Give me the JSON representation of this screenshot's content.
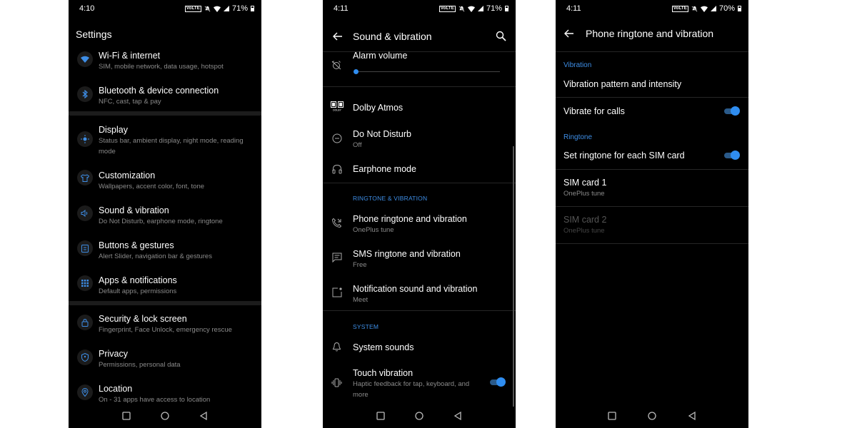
{
  "accent": "#3e8ee6",
  "screen1": {
    "status": {
      "time": "4:10",
      "battery": "71%",
      "volte": "VoLTE"
    },
    "title": "Settings",
    "items": [
      {
        "title": "Wi-Fi & internet",
        "sub": "SIM, mobile network, data usage, hotspot",
        "icon": "wifi-icon"
      },
      {
        "title": "Bluetooth & device connection",
        "sub": "NFC, cast, tap & pay",
        "icon": "bluetooth-icon"
      },
      {
        "title": "Display",
        "sub": "Status bar, ambient display, night mode, reading mode",
        "icon": "brightness-icon"
      },
      {
        "title": "Customization",
        "sub": "Wallpapers, accent color, font, tone",
        "icon": "shirt-icon"
      },
      {
        "title": "Sound & vibration",
        "sub": "Do Not Disturb, earphone mode, ringtone",
        "icon": "speaker-icon"
      },
      {
        "title": "Buttons & gestures",
        "sub": "Alert Slider, navigation bar & gestures",
        "icon": "buttons-icon"
      },
      {
        "title": "Apps & notifications",
        "sub": "Default apps, permissions",
        "icon": "apps-grid-icon"
      },
      {
        "title": "Security & lock screen",
        "sub": "Fingerprint, Face Unlock, emergency rescue",
        "icon": "lock-icon"
      },
      {
        "title": "Privacy",
        "sub": "Permissions, personal data",
        "icon": "shield-icon"
      },
      {
        "title": "Location",
        "sub": "On - 31 apps have access to location",
        "icon": "location-pin-icon"
      }
    ]
  },
  "screen2": {
    "status": {
      "time": "4:11",
      "battery": "71%",
      "volte": "VoLTE"
    },
    "title": "Sound & vibration",
    "alarm": {
      "title": "Alarm volume",
      "level": 0.0
    },
    "items_top": [
      {
        "title": "Dolby Atmos",
        "sub": ""
      },
      {
        "title": "Do Not Disturb",
        "sub": "Off"
      },
      {
        "title": "Earphone mode",
        "sub": ""
      }
    ],
    "section_ringtone": "RINGTONE & VIBRATION",
    "items_ringtone": [
      {
        "title": "Phone ringtone and vibration",
        "sub": "OnePlus tune"
      },
      {
        "title": "SMS ringtone and vibration",
        "sub": "Free"
      },
      {
        "title": "Notification sound and vibration",
        "sub": "Meet"
      }
    ],
    "section_system": "SYSTEM",
    "items_system": [
      {
        "title": "System sounds",
        "sub": ""
      },
      {
        "title": "Touch vibration",
        "sub": "Haptic feedback for tap, keyboard, and more",
        "toggle": true
      }
    ]
  },
  "screen3": {
    "status": {
      "time": "4:11",
      "battery": "70%",
      "volte": "VoLTE"
    },
    "title": "Phone ringtone and vibration",
    "section_vibration": "Vibration",
    "vibration_pattern": "Vibration pattern and intensity",
    "vibrate_calls": {
      "title": "Vibrate for calls",
      "toggle": true
    },
    "section_ringtone": "Ringtone",
    "set_each_sim": {
      "title": "Set ringtone for each SIM card",
      "toggle": true
    },
    "sim1": {
      "title": "SIM card 1",
      "sub": "OnePlus tune"
    },
    "sim2": {
      "title": "SIM card 2",
      "sub": "OnePlus tune",
      "disabled": true
    }
  }
}
